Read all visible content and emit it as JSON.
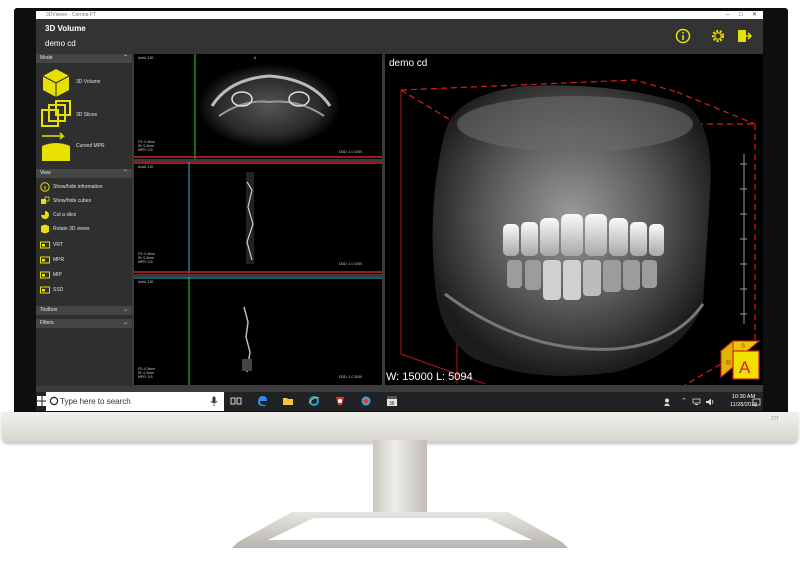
{
  "window": {
    "title": "3DViewer - Cornea FT"
  },
  "app": {
    "title": "3D Volume",
    "study": "demo cd"
  },
  "header_icons": [
    "info-icon",
    "gear-icon",
    "exit-icon"
  ],
  "colors": {
    "accent": "#e8e000",
    "panel": "#2f2f2f",
    "header": "#333333"
  },
  "sidebar": {
    "mode": {
      "label": "Mode",
      "items": [
        {
          "label": "3D Volume",
          "icon": "cube-icon"
        },
        {
          "label": "3D Slices",
          "icon": "slices-icon"
        },
        {
          "label": "Curved MPR",
          "icon": "curved-mpr-icon"
        }
      ]
    },
    "view": {
      "label": "View",
      "items": [
        {
          "label": "Show/hide information",
          "icon": "info-icon"
        },
        {
          "label": "Show/hide cubes",
          "icon": "cubes-icon"
        },
        {
          "label": "Cut a slice",
          "icon": "cut-icon"
        },
        {
          "label": "Rotate 3D views",
          "icon": "rotate-icon"
        },
        {
          "label": "VRT",
          "icon": "vrt-icon"
        },
        {
          "label": "MPR",
          "icon": "mpr-icon"
        },
        {
          "label": "MIP",
          "icon": "mip-icon"
        },
        {
          "label": "SSD",
          "icon": "ssd-icon"
        }
      ]
    },
    "toolbox": {
      "label": "Toolbox"
    },
    "filters": {
      "label": "Filters"
    }
  },
  "viewports": {
    "axial": {
      "top_left": "Axial: 120",
      "top_right": "A",
      "bottom_left": "FS: 0.3mm\nSt: 0.3mm\nMPR: 0.5",
      "bottom_right": "DDD: 1.0 1000"
    },
    "coronal": {
      "top_left": "Axial: 120",
      "bottom_left": "FS: 0.3mm\nSt: 0.3mm\nMPR: 0.5",
      "bottom_right": "DDD: 1.0 1000"
    },
    "sagittal": {
      "top_left": "Axial: 120",
      "bottom_left": "FS: 0.3mm\nSt: 0.3mm\nMPR: 0.5",
      "bottom_right": "DDD: 1.0 1000"
    },
    "volume": {
      "name": "demo cd",
      "window_level": "W: 15000 L: 5094",
      "cube_faces": [
        "R",
        "S",
        "A"
      ]
    }
  },
  "taskbar": {
    "search_placeholder": "Type here to search",
    "time": "10:30 AM",
    "date": "11/28/2018",
    "icons": [
      "start-icon",
      "task-view-icon",
      "edge-icon",
      "folder-icon",
      "ie-icon",
      "app-icon",
      "app-icon-2",
      "calendar-icon"
    ]
  },
  "monitor": {
    "model": "27f"
  }
}
